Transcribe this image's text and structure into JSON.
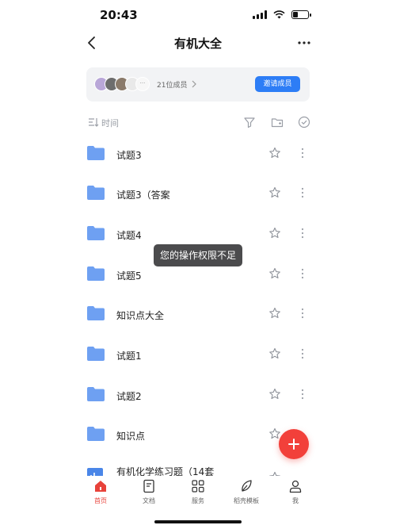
{
  "status_bar": {
    "time": "20:43",
    "battery_level": 0.35
  },
  "nav": {
    "title": "有机大全",
    "back_icon": "chevron-left-icon",
    "more_icon": "ellipsis-icon"
  },
  "members": {
    "count_label": "21位成员",
    "invite_label": "邀请成员",
    "avatar_colors": [
      "#b9a7d8",
      "#6d6d6d",
      "#8a7a6a",
      "#e9e9e9"
    ]
  },
  "toolbar": {
    "sort_label": "时间",
    "icons": [
      "sort-icon",
      "filter-icon",
      "new-folder-icon",
      "select-check-icon"
    ]
  },
  "files": [
    {
      "name": "试题3",
      "type": "folder"
    },
    {
      "name": "试题3（答案",
      "type": "folder"
    },
    {
      "name": "试题4",
      "type": "folder"
    },
    {
      "name": "试题5",
      "type": "folder"
    },
    {
      "name": "知识点大全",
      "type": "folder"
    },
    {
      "name": "试题1",
      "type": "folder"
    },
    {
      "name": "试题2",
      "type": "folder"
    },
    {
      "name": "知识点",
      "type": "folder"
    },
    {
      "name": "有机化学练习题（14套",
      "type": "chart-file"
    }
  ],
  "toast": {
    "message": "您的操作权限不足"
  },
  "tabs": [
    {
      "label": "首页",
      "icon": "home-icon",
      "active": true
    },
    {
      "label": "文档",
      "icon": "document-icon",
      "active": false
    },
    {
      "label": "服务",
      "icon": "grid-icon",
      "active": false
    },
    {
      "label": "稻壳模板",
      "icon": "leaf-icon",
      "active": false
    },
    {
      "label": "我",
      "icon": "user-icon",
      "active": false
    }
  ],
  "colors": {
    "accent_blue": "#2d7df6",
    "folder_blue": "#6ea0f2",
    "fab_red": "#f2403a",
    "active_tab_red": "#e8423a"
  }
}
